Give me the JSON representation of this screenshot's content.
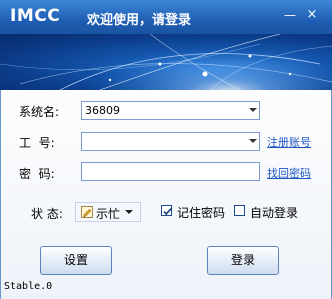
{
  "window": {
    "logo": "IMCC",
    "welcome": "欢迎使用，请登录",
    "minimize_symbol": "—",
    "close_symbol": "×"
  },
  "form": {
    "system_label": "系统名:",
    "system_value": "36809",
    "employee_label": "工  号:",
    "employee_value": "",
    "register_link": "注册账号",
    "password_label": "密  码:",
    "password_value": "",
    "recover_link": "找回密码",
    "status_label": "状 态:",
    "status_value": "示忙",
    "remember_password": {
      "label": "记住密码",
      "checked": true
    },
    "auto_login": {
      "label": "自动登录",
      "checked": false
    }
  },
  "buttons": {
    "settings": "设置",
    "login": "登录"
  },
  "footer": {
    "version": "Stable.0"
  },
  "colors": {
    "titlebar": "#1f5fb4",
    "link": "#1f57c3",
    "banner_glow": "#2d7fd9"
  }
}
